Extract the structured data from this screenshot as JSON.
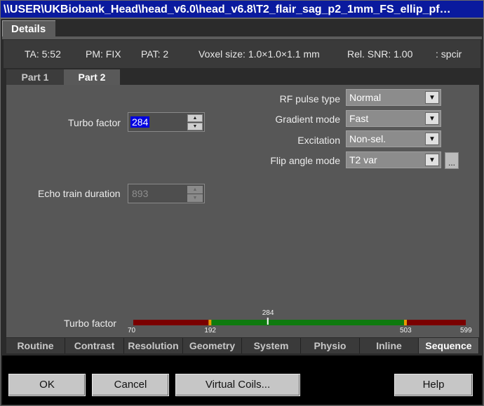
{
  "window": {
    "title": "\\\\USER\\UKBiobank_Head\\head_v6.0\\head_v6.8\\T2_flair_sag_p2_1mm_FS_ellip_pf…",
    "details_tab": "Details"
  },
  "info": {
    "ta": "TA: 5:52",
    "pm": "PM: FIX",
    "pat": "PAT: 2",
    "voxel": "Voxel size: 1.0×1.0×1.1 mm",
    "snr": "Rel. SNR: 1.00",
    "suffix": ": spcir"
  },
  "part_tabs": [
    "Part 1",
    "Part 2"
  ],
  "active_part": "Part 2",
  "turbo_factor": {
    "label": "Turbo factor",
    "value": "284"
  },
  "echo_train_duration": {
    "label": "Echo train duration",
    "value": "893"
  },
  "rf_pulse_type": {
    "label": "RF pulse type",
    "value": "Normal"
  },
  "gradient_mode": {
    "label": "Gradient mode",
    "value": "Fast"
  },
  "excitation": {
    "label": "Excitation",
    "value": "Non-sel."
  },
  "flip_angle_mode": {
    "label": "Flip angle mode",
    "value": "T2 var",
    "extra_button": "..."
  },
  "range_slider": {
    "label": "Turbo factor",
    "current": "284",
    "min": "70",
    "low": "192",
    "high": "503",
    "max": "599",
    "current_value": 284,
    "min_value": 70,
    "low_value": 192,
    "high_value": 503,
    "max_value": 599,
    "color_out_of_range": "#7a0000",
    "color_in_range": "#0e7a0e",
    "color_marker": "#e89a00"
  },
  "bottom_tabs": [
    "Routine",
    "Contrast",
    "Resolution",
    "Geometry",
    "System",
    "Physio",
    "Inline",
    "Sequence"
  ],
  "active_bottom_tab": "Sequence",
  "buttons": {
    "ok": "OK",
    "cancel": "Cancel",
    "virtual_coils": "Virtual Coils...",
    "help": "Help"
  }
}
